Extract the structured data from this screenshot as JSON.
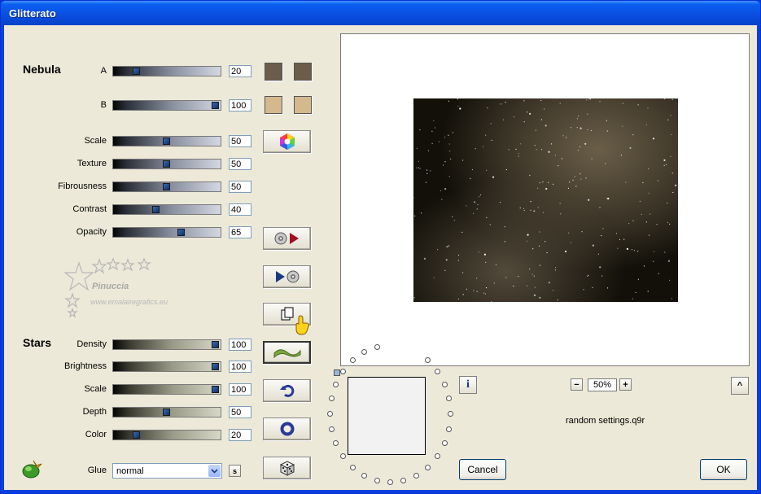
{
  "window": {
    "title": "Glitterato"
  },
  "nebula": {
    "section_label": "Nebula",
    "a": {
      "label": "A",
      "value": "20",
      "level": 0.2
    },
    "b": {
      "label": "B",
      "value": "100",
      "level": 1.0
    },
    "scale": {
      "label": "Scale",
      "value": "50",
      "level": 0.5
    },
    "texture": {
      "label": "Texture",
      "value": "50",
      "level": 0.5
    },
    "fibrousness": {
      "label": "Fibrousness",
      "value": "50",
      "level": 0.5
    },
    "contrast": {
      "label": "Contrast",
      "value": "40",
      "level": 0.4
    },
    "opacity": {
      "label": "Opacity",
      "value": "65",
      "level": 0.65
    },
    "color_a": "#6b5d4a",
    "color_b": "#d4b88e"
  },
  "stars": {
    "section_label": "Stars",
    "density": {
      "label": "Density",
      "value": "100",
      "level": 1.0
    },
    "brightness": {
      "label": "Brightness",
      "value": "100",
      "level": 1.0
    },
    "scale": {
      "label": "Scale",
      "value": "100",
      "level": 1.0
    },
    "depth": {
      "label": "Depth",
      "value": "50",
      "level": 0.5
    },
    "color": {
      "label": "Color",
      "value": "20",
      "level": 0.2
    }
  },
  "glue": {
    "label": "Glue",
    "value": "normal",
    "s_button": "s"
  },
  "watermark": {
    "name": "Pinuccia",
    "url": "www.emalairegrafics.eu"
  },
  "preview": {
    "zoom": "50%",
    "minus": "−",
    "plus": "+",
    "expand": "^"
  },
  "info_button": "i",
  "preset_name": "random settings.q9r",
  "buttons": {
    "cancel": "Cancel",
    "ok": "OK"
  },
  "colors": {
    "title_bar": "#0a4ee0",
    "dialog_bg": "#ece9d8"
  }
}
